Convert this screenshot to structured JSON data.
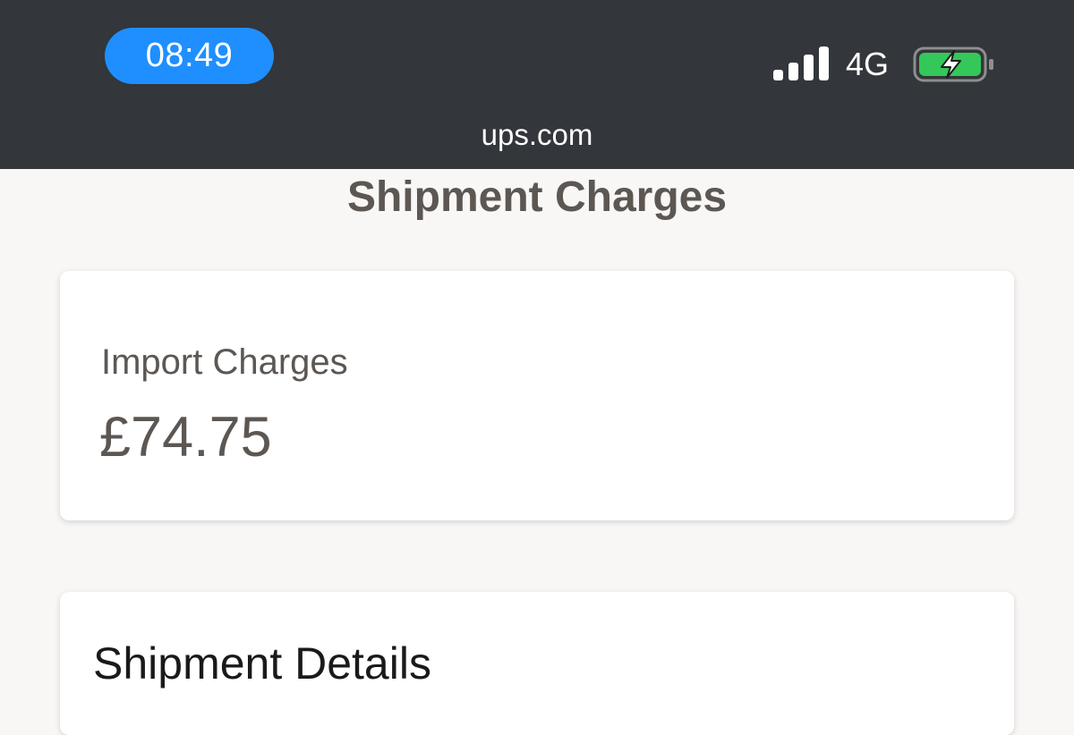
{
  "status_bar": {
    "time": "08:49",
    "network": "4G",
    "battery_charging": true,
    "signal_bars": 4,
    "icons": [
      "signal-icon",
      "battery-charging-icon"
    ],
    "colors": {
      "bar_bg": "#33363a",
      "time_pill": "#1f8fff",
      "battery_fill": "#34c759"
    }
  },
  "browser": {
    "url": "ups.com"
  },
  "page": {
    "title": "Shipment Charges"
  },
  "charges_card": {
    "label": "Import Charges",
    "amount": "£74.75"
  },
  "details_card": {
    "title": "Shipment Details"
  }
}
